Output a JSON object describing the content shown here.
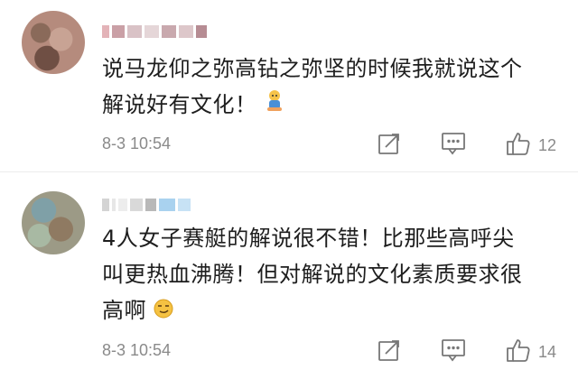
{
  "comments": [
    {
      "username": "",
      "text_line1": "说马龙仰之弥高钻之弥坚的时候我就说这个",
      "text_line2": "解说好有文化！",
      "timestamp": "8-3 10:54",
      "like_count": "12",
      "emoji_icon": "thumbs-up-boy-emoji-icon"
    },
    {
      "username": "",
      "text_line1": "4人女子赛艇的解说很不错！比那些高呼尖",
      "text_line2": "叫更热血沸腾！但对解说的文化素质要求很",
      "text_line3": "高啊",
      "timestamp": "8-3 10:54",
      "like_count": "14",
      "emoji_icon": "smirk-face-emoji-icon"
    }
  ],
  "icons": {
    "share": "share-icon",
    "comment": "comment-icon",
    "like": "thumbs-up-icon"
  },
  "colors": {
    "meta_text": "#8a8a8a",
    "body_text": "#1e1e1e",
    "icon_stroke": "#777777"
  }
}
